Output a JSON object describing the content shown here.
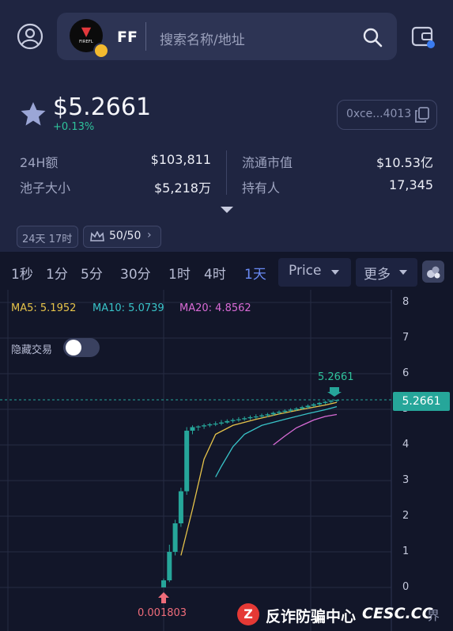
{
  "header": {
    "token_symbol": "FF",
    "logo_text": "FIREFL",
    "search_placeholder": "搜索名称/地址"
  },
  "summary": {
    "price": "$5.2661",
    "change": "+0.13%",
    "address": "0xce...4013"
  },
  "stats": [
    {
      "label": "24H额",
      "value": "$103,811"
    },
    {
      "label": "池子大小",
      "value": "$5,218万"
    },
    {
      "label": "流通市值",
      "value": "$10.53亿"
    },
    {
      "label": "持有人",
      "value": "17,345"
    }
  ],
  "chips": {
    "age": "24天 17时",
    "score": "50/50"
  },
  "timeframes": [
    "1秒",
    "1分",
    "5分",
    "30分",
    "1时",
    "4时",
    "1天"
  ],
  "active_timeframe": "1天",
  "price_dropdown": "Price",
  "more_dropdown": "更多",
  "indicators": {
    "ma5": "MA5: 5.1952",
    "ma10": "MA10: 5.0739",
    "ma20": "MA20: 4.8562"
  },
  "hide_trades_label": "隐藏交易",
  "colors": {
    "up": "#26a69a",
    "accent": "#6a8bf5",
    "ma5": "#e6c34a",
    "ma10": "#38c3c8",
    "ma20": "#d96bd6",
    "low_marker": "#ef6c7a"
  },
  "chart_data": {
    "type": "candlestick",
    "y_ticks": [
      "8",
      "7",
      "6",
      "5",
      "4",
      "3",
      "2",
      "1",
      "0"
    ],
    "ylim": [
      0,
      8
    ],
    "last_price_label": "5.2661",
    "high_label": "5.2661",
    "low_label": "0.001803",
    "candles": [
      {
        "o": 0.002,
        "h": 0.25,
        "l": 0.0018,
        "c": 0.2
      },
      {
        "o": 0.2,
        "h": 1.2,
        "l": 0.15,
        "c": 1.0
      },
      {
        "o": 1.0,
        "h": 1.9,
        "l": 0.9,
        "c": 1.8
      },
      {
        "o": 1.8,
        "h": 2.8,
        "l": 1.7,
        "c": 2.7
      },
      {
        "o": 2.7,
        "h": 4.5,
        "l": 2.6,
        "c": 4.4
      },
      {
        "o": 4.4,
        "h": 4.55,
        "l": 4.3,
        "c": 4.5
      },
      {
        "o": 4.5,
        "h": 4.55,
        "l": 4.4,
        "c": 4.52
      },
      {
        "o": 4.52,
        "h": 4.6,
        "l": 4.45,
        "c": 4.55
      },
      {
        "o": 4.55,
        "h": 4.62,
        "l": 4.5,
        "c": 4.58
      },
      {
        "o": 4.58,
        "h": 4.66,
        "l": 4.53,
        "c": 4.6
      },
      {
        "o": 4.6,
        "h": 4.7,
        "l": 4.55,
        "c": 4.63
      },
      {
        "o": 4.63,
        "h": 4.72,
        "l": 4.6,
        "c": 4.67
      },
      {
        "o": 4.67,
        "h": 4.75,
        "l": 4.62,
        "c": 4.7
      },
      {
        "o": 4.7,
        "h": 4.78,
        "l": 4.65,
        "c": 4.72
      },
      {
        "o": 4.72,
        "h": 4.8,
        "l": 4.68,
        "c": 4.75
      },
      {
        "o": 4.75,
        "h": 4.83,
        "l": 4.7,
        "c": 4.78
      },
      {
        "o": 4.78,
        "h": 4.86,
        "l": 4.73,
        "c": 4.8
      },
      {
        "o": 4.8,
        "h": 4.88,
        "l": 4.76,
        "c": 4.83
      },
      {
        "o": 4.83,
        "h": 4.9,
        "l": 4.78,
        "c": 4.86
      },
      {
        "o": 4.86,
        "h": 4.94,
        "l": 4.82,
        "c": 4.9
      },
      {
        "o": 4.9,
        "h": 4.97,
        "l": 4.85,
        "c": 4.93
      },
      {
        "o": 4.93,
        "h": 5.0,
        "l": 4.88,
        "c": 4.96
      },
      {
        "o": 4.96,
        "h": 5.03,
        "l": 4.92,
        "c": 4.99
      },
      {
        "o": 4.99,
        "h": 5.06,
        "l": 4.95,
        "c": 5.02
      },
      {
        "o": 5.02,
        "h": 5.1,
        "l": 4.98,
        "c": 5.06
      },
      {
        "o": 5.06,
        "h": 5.14,
        "l": 5.02,
        "c": 5.1
      },
      {
        "o": 5.1,
        "h": 5.18,
        "l": 5.06,
        "c": 5.14
      },
      {
        "o": 5.14,
        "h": 5.21,
        "l": 5.1,
        "c": 5.18
      },
      {
        "o": 5.18,
        "h": 5.24,
        "l": 5.14,
        "c": 5.21
      },
      {
        "o": 5.21,
        "h": 5.27,
        "l": 5.17,
        "c": 5.24
      },
      {
        "o": 5.24,
        "h": 5.2661,
        "l": 5.2,
        "c": 5.2661
      }
    ],
    "ma5_series": [
      {
        "i": 3,
        "v": 0.9
      },
      {
        "i": 5,
        "v": 2.2
      },
      {
        "i": 7,
        "v": 3.6
      },
      {
        "i": 9,
        "v": 4.3
      },
      {
        "i": 12,
        "v": 4.55
      },
      {
        "i": 16,
        "v": 4.72
      },
      {
        "i": 20,
        "v": 4.87
      },
      {
        "i": 24,
        "v": 5.0
      },
      {
        "i": 28,
        "v": 5.12
      },
      {
        "i": 30,
        "v": 5.1952
      }
    ],
    "ma10_series": [
      {
        "i": 9,
        "v": 3.1
      },
      {
        "i": 10,
        "v": 3.4
      },
      {
        "i": 12,
        "v": 3.95
      },
      {
        "i": 14,
        "v": 4.3
      },
      {
        "i": 17,
        "v": 4.55
      },
      {
        "i": 21,
        "v": 4.72
      },
      {
        "i": 25,
        "v": 4.88
      },
      {
        "i": 28,
        "v": 4.99
      },
      {
        "i": 30,
        "v": 5.0739
      }
    ],
    "ma20_series": [
      {
        "i": 19,
        "v": 4.0
      },
      {
        "i": 21,
        "v": 4.25
      },
      {
        "i": 23,
        "v": 4.48
      },
      {
        "i": 26,
        "v": 4.7
      },
      {
        "i": 28,
        "v": 4.8
      },
      {
        "i": 30,
        "v": 4.8562
      }
    ]
  },
  "watermark": {
    "text_cn": "反诈防骗中心",
    "text_en": "CESC.CC",
    "icon_letter": "Z",
    "partial": "界"
  }
}
